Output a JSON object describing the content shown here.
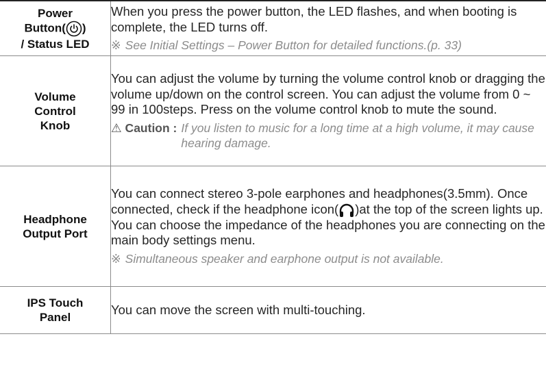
{
  "rows": [
    {
      "label_line1": "Power",
      "label_line2_pre": "Button(",
      "label_line2_post": ")",
      "label_line3": "/ Status LED",
      "description": "When you press the power button, the LED flashes, and when booting is complete, the LED turns off.",
      "note_symbol": "※",
      "note": "See Initial Settings – Power Button for detailed functions.(p. 33)"
    },
    {
      "label_line1": "Volume",
      "label_line2": "Control",
      "label_line3": "Knob",
      "description": "You can adjust the volume by turning the volume control knob or dragging the volume up/down on the control screen. You can adjust the volume from 0 ~ 99 in 100steps. Press on the volume control knob to mute the sound.",
      "caution_label": "⚠ Caution :",
      "caution_text": "If you listen to music for a long time at a high volume, it may cause hearing damage."
    },
    {
      "label_line1": "Headphone",
      "label_line2": "Output Port",
      "description_pre": "You can connect stereo 3-pole earphones and headphones(3.5mm). Once connected, check if the headphone icon(",
      "description_post": ")at the top of the screen lights up.",
      "description_line2": "You can choose the impedance of the headphones you are connecting on the main body settings menu.",
      "note_symbol": "※",
      "note": "Simultaneous speaker and earphone output is not available."
    },
    {
      "label_line1": "IPS Touch",
      "label_line2": "Panel",
      "description": "You can move the screen with multi-touching."
    }
  ],
  "icons": {
    "power": "power-icon",
    "headphone": "headphone-icon"
  },
  "colors": {
    "text": "#262626",
    "note": "#8c8c8c",
    "border": "#8a8a8a"
  }
}
